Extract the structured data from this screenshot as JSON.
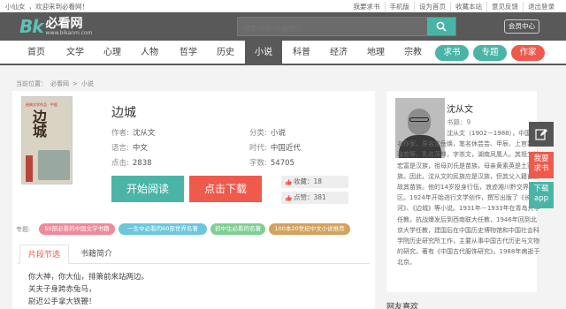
{
  "topbar": {
    "user": "小仙女",
    "welcome": "，欢迎来到必看网！",
    "links": [
      "我要求书",
      "手机版",
      "设为首页",
      "收藏本站",
      "意见反馈",
      "退出登录"
    ]
  },
  "header": {
    "logo_mark": "Bk",
    "logo_cn": "必看网",
    "logo_url": "www.bikanm.com",
    "search_placeholder": "搜索书名\\作者姓名",
    "member_label": "会员中心"
  },
  "nav": {
    "items": [
      "首页",
      "文学",
      "心理",
      "人物",
      "哲学",
      "历史",
      "小说",
      "科普",
      "经济",
      "地理",
      "宗教"
    ],
    "active": "小说",
    "pills": [
      {
        "label": "求书",
        "color": "#4ab5a7"
      },
      {
        "label": "专题",
        "color": "#4ab5a7"
      },
      {
        "label": "作家",
        "color": "#ef5a4c"
      }
    ]
  },
  "breadcrumb": [
    "当前位置：",
    "必看网",
    ">",
    "小说"
  ],
  "book": {
    "cover_label": "经典文学作品 · 中国",
    "cover_title": "边城",
    "title": "边城",
    "author_label": "作者:",
    "author": "沈从文",
    "category_label": "分类:",
    "category": "小说",
    "language_label": "语言:",
    "language": "中文",
    "era_label": "时代:",
    "era": "中国近代",
    "clicks_label": "点击:",
    "clicks": "2838",
    "words_label": "字数:",
    "words": "54705",
    "favorites": "收藏：18",
    "likes": "点赞：381",
    "read_button": "开始阅读",
    "download_button": "点击下载"
  },
  "tags": {
    "label": "专题:",
    "items": [
      {
        "label": "50部必看的中国文学书籍",
        "color": "#f08a9a"
      },
      {
        "label": "一生中必看的60部世界名著",
        "color": "#6cc7dd"
      },
      {
        "label": "初中生必看的名著",
        "color": "#7fcf93"
      },
      {
        "label": "100本20世纪中文小说推荐",
        "color": "#d3a25e"
      }
    ]
  },
  "tabs": [
    "片段节选",
    "书籍简介"
  ],
  "excerpt": [
    "你大神，你大仙，排箫前来站两边。",
    "关夫子身跨赤兔马，",
    "尉迟公手拿大铁鞭！"
  ],
  "author": {
    "name": "沈从文",
    "books": "书籍：9",
    "bio": "沈从文（1902－1988），中国著名作家，原名沈岳焕，笔名休芸芸、甲辰、上官碧、璇若等，乳名茂林，字崇文，湖南凤凰人。其祖父沈宏富是汉族，祖母刘氏是苗族，母亲黄素英是土家族。因此，沈从文的民族应是汉族，但其父入籍苗族故其苗族。他的14岁投身行伍，浪迹湘川黔交界地区。1924年开始进行文学创作，撰写出版了《长河》、《边城》等小说。1931年－1933年在青岛大学任教，抗战爆发后到西南联大任教，1946年回到北京大学任教，建国后在中国历史博物馆和中国社会科学院历史研究所工作，主要从事中国古代历史与文物的研究，著有《中国古代服饰研究》。1988年病逝于北京。",
    "recent_label": "网友喜欢"
  },
  "side": {
    "ask": [
      "我要",
      "求书"
    ],
    "app": [
      "下载",
      "app"
    ]
  }
}
